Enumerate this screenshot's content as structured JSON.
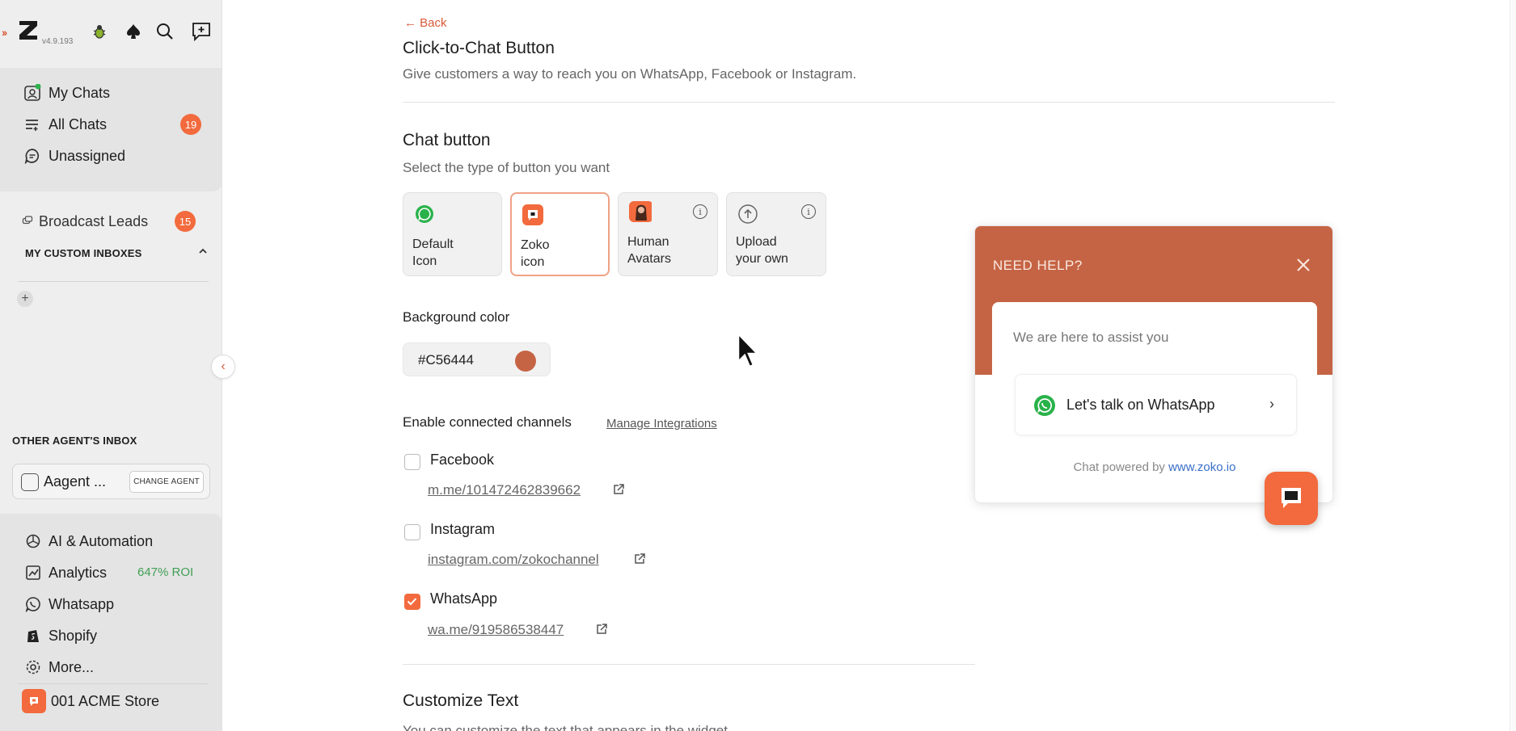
{
  "app": {
    "version": "v4.9.193",
    "accent": "#F26A3D"
  },
  "sidebar": {
    "nav": [
      {
        "label": "My Chats",
        "icon": "my-chats-icon"
      },
      {
        "label": "All Chats",
        "icon": "all-chats-icon",
        "badge": "19"
      },
      {
        "label": "Unassigned",
        "icon": "unassigned-icon"
      }
    ],
    "broadcast": {
      "label": "Broadcast Leads",
      "badge": "15"
    },
    "custom_inboxes_title": "MY CUSTOM INBOXES",
    "other_agents_title": "OTHER AGENT'S INBOX",
    "agent": {
      "name": "Aagent ...",
      "change_label": "CHANGE AGENT"
    },
    "bottom_nav": [
      {
        "label": "AI & Automation",
        "icon": "openai-icon"
      },
      {
        "label": "Analytics",
        "icon": "analytics-icon",
        "extra": "647% ROI"
      },
      {
        "label": "Whatsapp",
        "icon": "whatsapp-icon"
      },
      {
        "label": "Shopify",
        "icon": "shopify-icon"
      },
      {
        "label": "More...",
        "icon": "gear-icon"
      },
      {
        "label": "001 ACME Store",
        "icon": "store-logo-icon"
      }
    ]
  },
  "main": {
    "back_label": "← Back",
    "title": "Click-to-Chat Button",
    "subtitle": "Give customers a way to reach you on WhatsApp, Facebook or Instagram.",
    "chat_button": {
      "heading": "Chat button",
      "description": "Select the type of button you want",
      "options": [
        {
          "line1": "Default",
          "line2": "Icon",
          "selected": false
        },
        {
          "line1": "Zoko",
          "line2": "icon",
          "selected": true
        },
        {
          "line1": "Human",
          "line2": "Avatars",
          "selected": false
        },
        {
          "line1": "Upload",
          "line2": "your own",
          "selected": false
        }
      ]
    },
    "background_color": {
      "label": "Background color",
      "value": "#C56444"
    },
    "channels": {
      "label": "Enable connected channels",
      "manage_label": "Manage Integrations",
      "items": [
        {
          "name": "Facebook",
          "link": "m.me/101472462839662",
          "checked": false
        },
        {
          "name": "Instagram",
          "link": "instagram.com/zokochannel",
          "checked": false
        },
        {
          "name": "WhatsApp",
          "link": "wa.me/919586538447",
          "checked": true
        }
      ]
    },
    "customize": {
      "heading": "Customize Text",
      "description": "You can customize the text that appears in the widget"
    }
  },
  "preview": {
    "header": "NEED HELP?",
    "assist": "We are here to assist you",
    "whatsapp_button": "Let's talk on WhatsApp",
    "powered_prefix": "Chat powered by",
    "powered_link": "www.zoko.io",
    "color": "#C56444"
  }
}
